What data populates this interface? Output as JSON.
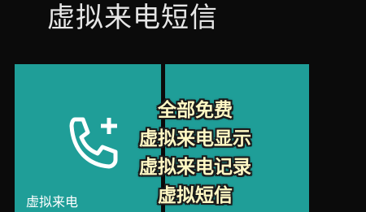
{
  "screen": {
    "title": "虚拟来电短信"
  },
  "tiles": [
    {
      "label": "虚拟来电",
      "icon": "phone-plus-icon",
      "color": "#1f9e98"
    },
    {
      "label": "",
      "color": "#1f9e98"
    }
  ],
  "overlay": {
    "lines": [
      "全部免费",
      "虚拟来电显示",
      "虚拟来电记录",
      "虚拟短信"
    ],
    "text_color": "#fff8c4",
    "outline_color": "#1a1a1a"
  }
}
